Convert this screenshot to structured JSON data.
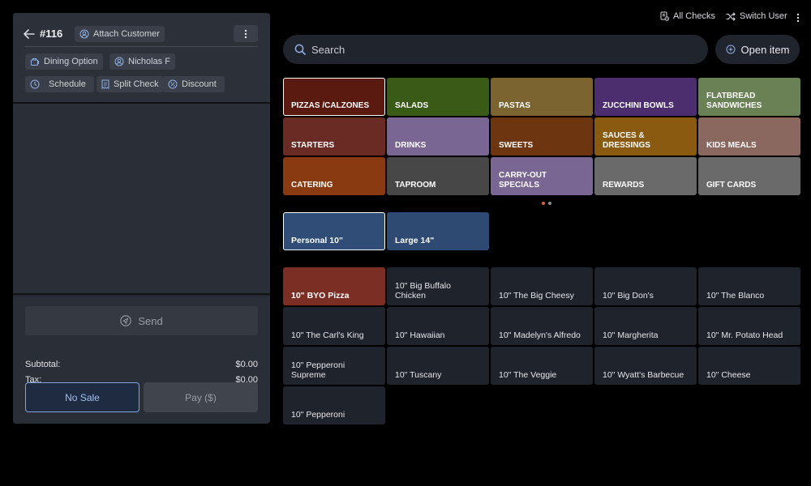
{
  "check": {
    "number": "#116",
    "attach_customer": "Attach Customer",
    "dining_option": "Dining Option",
    "server": "Nicholas F",
    "schedule": "Schedule",
    "split_check": "Split Check",
    "discount": "Discount",
    "send": "Send",
    "subtotal_label": "Subtotal:",
    "subtotal_value": "$0.00",
    "tax_label": "Tax:",
    "tax_value": "$0.00",
    "no_sale": "No Sale",
    "pay": "Pay ($)"
  },
  "topbar": {
    "all_checks": "All Checks",
    "switch_user": "Switch User"
  },
  "search": {
    "placeholder": "Search"
  },
  "open_item": "Open item",
  "categories": [
    {
      "label": "PIZZAS /CALZONES",
      "color": "#5b1a10",
      "selected": true
    },
    {
      "label": "SALADS",
      "color": "#3a5a17"
    },
    {
      "label": "PASTAS",
      "color": "#7c6430"
    },
    {
      "label": "ZUCCHINI BOWLS",
      "color": "#4c2e6e"
    },
    {
      "label": "FLATBREAD SANDWICHES",
      "color": "#6a8055"
    },
    {
      "label": "STARTERS",
      "color": "#6a2b25"
    },
    {
      "label": "DRINKS",
      "color": "#7a6693"
    },
    {
      "label": "SWEETS",
      "color": "#6e3610"
    },
    {
      "label": "SAUCES & DRESSINGS",
      "color": "#8a5a10"
    },
    {
      "label": "KIDS MEALS",
      "color": "#8a6860"
    },
    {
      "label": "CATERING",
      "color": "#8a3a10"
    },
    {
      "label": "TAPROOM",
      "color": "#474747"
    },
    {
      "label": "CARRY-OUT SPECIALS",
      "color": "#7a6693"
    },
    {
      "label": "REWARDS",
      "color": "#6a6a6a"
    },
    {
      "label": "GIFT CARDS",
      "color": "#6a6a6a"
    }
  ],
  "pager_colors": [
    "#d9603a",
    "#8a8d93"
  ],
  "sizes": [
    {
      "label": "Personal 10\"",
      "selected": true
    },
    {
      "label": "Large 14\""
    }
  ],
  "items": [
    {
      "label": "10\" BYO Pizza",
      "highlight": true
    },
    {
      "label": "10\" Big Buffalo Chicken"
    },
    {
      "label": "10\" The Big Cheesy"
    },
    {
      "label": "10\" Big Don's"
    },
    {
      "label": "10\" The Blanco"
    },
    {
      "label": "10\" The Carl's King"
    },
    {
      "label": "10\" Hawaiian"
    },
    {
      "label": "10\" Madelyn's Alfredo"
    },
    {
      "label": "10\" Margherita"
    },
    {
      "label": "10\" Mr. Potato Head"
    },
    {
      "label": "10\" Pepperoni Supreme"
    },
    {
      "label": "10\" Tuscany"
    },
    {
      "label": "10\" The Veggie"
    },
    {
      "label": "10\" Wyatt's Barbecue"
    },
    {
      "label": "10\" Cheese"
    },
    {
      "label": "10\" Pepperoni"
    }
  ]
}
